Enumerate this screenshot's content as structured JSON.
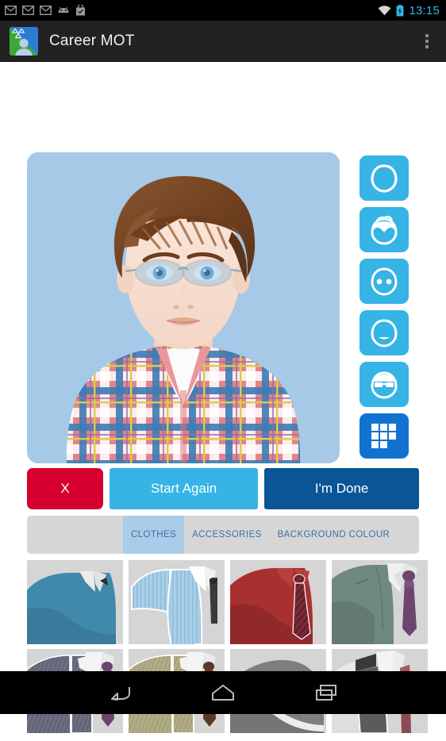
{
  "status_bar": {
    "icons": [
      "gmail-icon",
      "gmail-icon",
      "gmail-icon",
      "android-icon",
      "play-store-icon"
    ],
    "wifi_icon": "wifi-icon",
    "battery_icon": "battery-charging-icon",
    "time": "13:15",
    "accent_color": "#33b5e5"
  },
  "action_bar": {
    "app_icon": "career-mot-app-icon",
    "title": "Career MOT",
    "overflow_icon": "overflow-menu-icon"
  },
  "avatar": {
    "background_color": "#a5c9e6",
    "hair_color": "#7a4a28",
    "skin_color": "#f6ded2",
    "eye_color": "#3f93d8",
    "shirt_description": "plaid check shirt",
    "shirt_colors": [
      "#e07a7f",
      "#3d7cb5",
      "#ffffff",
      "#d4c84a"
    ]
  },
  "feature_toolbar": {
    "buttons": [
      {
        "name": "face-shape-icon",
        "label": "Face Shape",
        "selected": false
      },
      {
        "name": "hair-icon",
        "label": "Hair",
        "selected": false
      },
      {
        "name": "eyes-icon",
        "label": "Eyes",
        "selected": false
      },
      {
        "name": "mouth-icon",
        "label": "Mouth",
        "selected": false
      },
      {
        "name": "glasses-icon",
        "label": "Glasses",
        "selected": false
      },
      {
        "name": "grid-icon",
        "label": "Clothes Grid",
        "selected": true
      }
    ],
    "color": "#35b4e5",
    "selected_color": "#1172cf"
  },
  "buttons": {
    "cancel_label": "X",
    "cancel_color": "#d50030",
    "restart_label": "Start Again",
    "restart_color": "#35b4e5",
    "done_label": "I'm Done",
    "done_color": "#0a5596"
  },
  "tabs": {
    "items": [
      {
        "label": "CLOTHES",
        "selected": true
      },
      {
        "label": "ACCESSORIES",
        "selected": false
      },
      {
        "label": "BACKGROUND COLOUR",
        "selected": false
      }
    ],
    "bar_color": "#d6d6d6",
    "selected_color": "#a9cce8",
    "text_color": "#3e6f9e"
  },
  "clothing_grid": {
    "cell_background": "#d5d5d5",
    "items": [
      {
        "name": "blue-polo-shirt",
        "type": "polo",
        "body": "#4189ab",
        "collar": "#ececec",
        "tie": null
      },
      {
        "name": "light-blue-striped-shirt",
        "type": "shirt",
        "body": "#a9cfe8",
        "collar": "#ffffff",
        "tie": "#3a3a3a"
      },
      {
        "name": "red-shirt-with-tie",
        "type": "shirt",
        "body": "#a8302f",
        "collar": "#b8403f",
        "tie": "#7a2b37"
      },
      {
        "name": "green-grey-suit-purple-tie",
        "type": "suit",
        "body": "#6f8881",
        "collar": "#f0f0f0",
        "tie": "#6d456e"
      },
      {
        "name": "grey-pinstripe-suit-purple-tie",
        "type": "suit",
        "body": "#6c6e82",
        "collar": "#f2f2f2",
        "tie": "#6d456e"
      },
      {
        "name": "khaki-suit-brown-tie",
        "type": "suit",
        "body": "#b0ad86",
        "collar": "#f2f2f2",
        "tie": "#5d3726"
      },
      {
        "name": "grey-plain-top",
        "type": "top",
        "body": "#7e7e7e",
        "collar": null,
        "tie": null
      },
      {
        "name": "dark-grey-jacket-red-tie",
        "type": "jacket",
        "body": "#5b5b5b",
        "collar": "#f0f0f0",
        "tie": "#8e4a52"
      }
    ]
  },
  "nav_bar": {
    "back_icon": "back-arrow-icon",
    "home_icon": "home-icon",
    "recents_icon": "recent-apps-icon"
  }
}
